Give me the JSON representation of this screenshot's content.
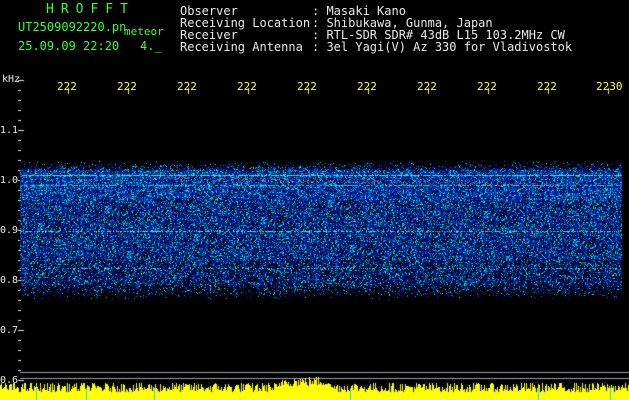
{
  "header": {
    "logo": "HROFFT",
    "file_name": "UT2509092220.pn",
    "meteor_label": "meteor",
    "date_time": "25.09.09 22:20",
    "counter": "4._"
  },
  "info": [
    {
      "label": "Observer",
      "value": ": Masaki Kano"
    },
    {
      "label": "Receiving Location",
      "value": ": Shibukawa, Gunma, Japan"
    },
    {
      "label": "Receiver",
      "value": ": RTL-SDR SDR# 43dB L15 103.2MHz CW"
    },
    {
      "label": "Receiving Antenna",
      "value": ": 3el Yagi(V) Az 330 for Vladivostok"
    }
  ],
  "axis": {
    "y_unit": "kHz",
    "y_ticks": [
      "1.1",
      "1.0",
      "0.9",
      "0.8",
      "0.7",
      "0.6"
    ],
    "x_ticks": [
      "222",
      "222",
      "222",
      "222",
      "222",
      "222",
      "222",
      "222",
      "222",
      "2230"
    ]
  },
  "colors": {
    "logo": "#33ff33",
    "text": "#e8e8e8",
    "tick_marks": "#ffff33",
    "signal_strip": "#ffff00",
    "background": "#000000"
  }
}
